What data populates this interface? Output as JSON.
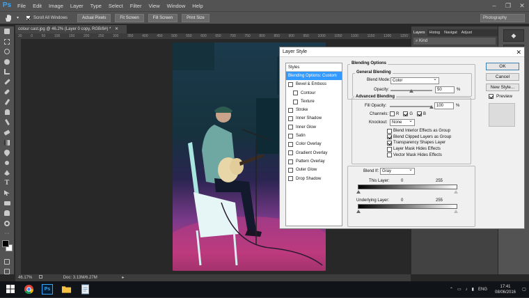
{
  "app": {
    "logo": "Ps",
    "menu": [
      "File",
      "Edit",
      "Image",
      "Layer",
      "Type",
      "Select",
      "Filter",
      "View",
      "Window",
      "Help"
    ],
    "window_controls": [
      "–",
      "❐",
      "✕"
    ]
  },
  "options_bar": {
    "scroll_all_windows": "Scroll All Windows",
    "buttons": [
      "Actual Pixels",
      "Fit Screen",
      "Fill Screen",
      "Print Size"
    ],
    "workspace": "Photography"
  },
  "document": {
    "tab_title": "colour cast.jpg @ 46.2% (Layer 0 copy, RGB/8#) *",
    "ruler_ticks": [
      "30",
      "0",
      "50",
      "100",
      "150",
      "200",
      "250",
      "300",
      "350",
      "400",
      "450",
      "500",
      "550",
      "600",
      "650",
      "700",
      "750",
      "800",
      "850",
      "900",
      "950",
      "1000",
      "1050",
      "1100",
      "1150",
      "1200",
      "1250"
    ],
    "zoom": "46.17%",
    "doc_size": "Doc: 3.13M/6.27M"
  },
  "panels": {
    "tabs": [
      "Layers",
      "Histog",
      "Navigat",
      "Adjust"
    ],
    "kind_label": "Kind"
  },
  "dialog": {
    "title": "Layer Style",
    "close": "✕",
    "styles_header": "Styles",
    "styles": [
      {
        "label": "Blending Options: Custom",
        "selected": true,
        "checkbox": false,
        "indent": false
      },
      {
        "label": "Bevel & Emboss",
        "checkbox": true,
        "indent": false
      },
      {
        "label": "Contour",
        "checkbox": true,
        "indent": true
      },
      {
        "label": "Texture",
        "checkbox": true,
        "indent": true
      },
      {
        "label": "Stroke",
        "checkbox": true,
        "indent": false
      },
      {
        "label": "Inner Shadow",
        "checkbox": true,
        "indent": false
      },
      {
        "label": "Inner Glow",
        "checkbox": true,
        "indent": false
      },
      {
        "label": "Satin",
        "checkbox": true,
        "indent": false
      },
      {
        "label": "Color Overlay",
        "checkbox": true,
        "indent": false
      },
      {
        "label": "Gradient Overlay",
        "checkbox": true,
        "indent": false
      },
      {
        "label": "Pattern Overlay",
        "checkbox": true,
        "indent": false
      },
      {
        "label": "Outer Glow",
        "checkbox": true,
        "indent": false
      },
      {
        "label": "Drop Shadow",
        "checkbox": true,
        "indent": false
      }
    ],
    "blending_options": "Blending Options",
    "general_blending": "General Blending",
    "blend_mode_label": "Blend Mode:",
    "blend_mode_value": "Color",
    "opacity_label": "Opacity:",
    "opacity_value": "50",
    "opacity_fraction": 0.5,
    "percent": "%",
    "advanced_blending": "Advanced Blending",
    "fill_opacity_label": "Fill Opacity:",
    "fill_opacity_value": "100",
    "fill_opacity_fraction": 1.0,
    "channels_label": "Channels:",
    "channels": [
      {
        "label": "R",
        "checked": false
      },
      {
        "label": "G",
        "checked": true
      },
      {
        "label": "B",
        "checked": true
      }
    ],
    "knockout_label": "Knockout:",
    "knockout_value": "None",
    "adv_checks": [
      {
        "label": "Blend Interior Effects as Group",
        "checked": false
      },
      {
        "label": "Blend Clipped Layers as Group",
        "checked": true
      },
      {
        "label": "Transparency Shapes Layer",
        "checked": true
      },
      {
        "label": "Layer Mask Hides Effects",
        "checked": false
      },
      {
        "label": "Vector Mask Hides Effects",
        "checked": false
      }
    ],
    "blend_if_label": "Blend If:",
    "blend_if_value": "Gray",
    "this_layer_label": "This Layer:",
    "this_layer_min": "0",
    "this_layer_max": "255",
    "underlying_label": "Underlying Layer:",
    "underlying_min": "0",
    "underlying_max": "255",
    "ok": "OK",
    "cancel": "Cancel",
    "new_style": "New Style...",
    "preview_label": "Preview",
    "preview_checked": true
  },
  "taskbar": {
    "language": "ENG",
    "time": "17:41",
    "date": "08/06/2016"
  },
  "colors": {
    "ps_blue": "#31a8ff",
    "selected_row": "#3399ff",
    "chrome_dark": "#535353"
  }
}
